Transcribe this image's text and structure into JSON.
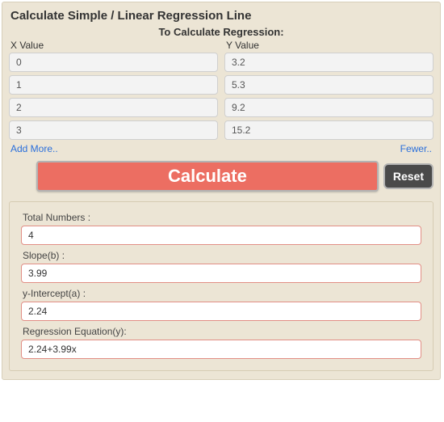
{
  "heading": "Calculate Simple / Linear Regression Line",
  "subheading": "To Calculate Regression:",
  "columns": {
    "x_label": "X Value",
    "y_label": "Y Value",
    "x_values": [
      "0",
      "1",
      "2",
      "3"
    ],
    "y_values": [
      "3.2",
      "5.3",
      "9.2",
      "15.2"
    ]
  },
  "links": {
    "add_more": "Add More..",
    "fewer": "Fewer.."
  },
  "buttons": {
    "calculate": "Calculate",
    "reset": "Reset"
  },
  "results": {
    "total_label": "Total Numbers :",
    "total_value": "4",
    "slope_label": "Slope(b) :",
    "slope_value": "3.99",
    "intercept_label": "y-Intercept(a) :",
    "intercept_value": "2.24",
    "equation_label": "Regression Equation(y):",
    "equation_value": "2.24+3.99x"
  }
}
